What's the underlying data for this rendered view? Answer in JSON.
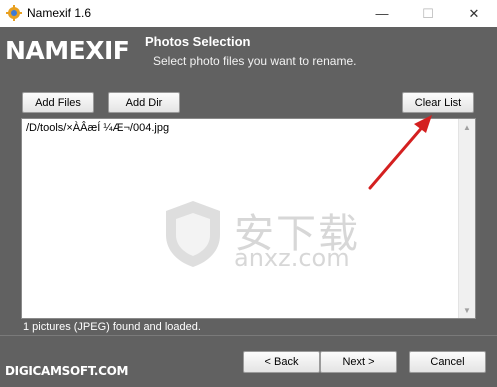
{
  "window": {
    "title": "Namexif 1.6",
    "controls": {
      "minimize": "—",
      "maximize": "☐",
      "close": "✕"
    }
  },
  "header": {
    "logo": "NAMEXIF",
    "title": "Photos Selection",
    "subtitle": "Select photo files you want to rename."
  },
  "toolbar": {
    "add_files": "Add Files",
    "add_dir": "Add Dir",
    "clear_list": "Clear List"
  },
  "file_list": {
    "items": [
      "/D/tools/×ÀÂæÍ ¼Æ¬/004.jpg"
    ]
  },
  "watermark": {
    "cn_text": "安下载",
    "url": "anxz.com"
  },
  "status": "1 pictures (JPEG) found and loaded.",
  "footer": {
    "brand": "DIGICAMSOFT.COM",
    "back": "< Back",
    "next": "Next >",
    "cancel": "Cancel"
  },
  "colors": {
    "panel_bg": "#616161",
    "arrow": "#d42020"
  }
}
